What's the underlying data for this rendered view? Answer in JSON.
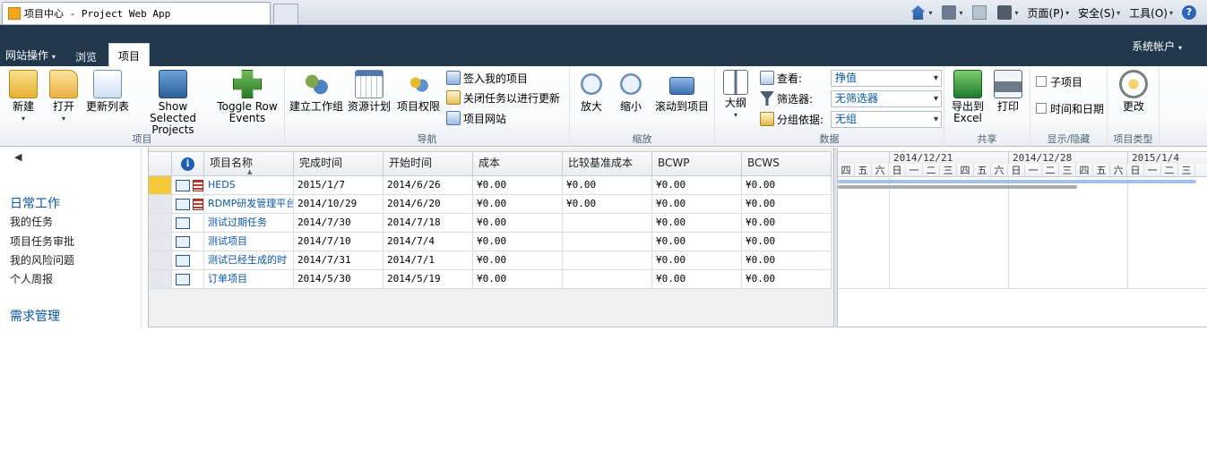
{
  "browser": {
    "tab_title": "项目中心 - Project Web App",
    "commands": [
      {
        "label": "",
        "icon": "home-icon"
      },
      {
        "label": "",
        "icon": "rss-icon"
      },
      {
        "label": "",
        "icon": "mail-icon"
      },
      {
        "label": "",
        "icon": "print-icon"
      },
      {
        "label": "页面(P)",
        "icon": ""
      },
      {
        "label": "安全(S)",
        "icon": ""
      },
      {
        "label": "工具(O)",
        "icon": ""
      },
      {
        "label": "",
        "icon": "help-icon"
      }
    ]
  },
  "header": {
    "site_actions": "网站操作",
    "tab_browse": "浏览",
    "tab_project": "项目",
    "account": "系统帐户"
  },
  "ribbon": {
    "group_project": {
      "label": "项目",
      "new": "新建",
      "open": "打开",
      "refresh_list": "更新列表",
      "show_selected_1": "Show Selected",
      "show_selected_2": "Projects",
      "toggle_row_1": "Toggle Row",
      "toggle_row_2": "Events"
    },
    "group_navigate": {
      "label": "导航",
      "build_team": "建立工作组",
      "resource_plan": "资源计划",
      "project_permissions": "项目权限",
      "check_in": "签入我的项目",
      "close_tasks": "关闭任务以进行更新",
      "project_site": "项目网站"
    },
    "group_zoom": {
      "label": "缩放",
      "zoom_in": "放大",
      "zoom_out": "缩小",
      "scroll_to_project": "滚动到项目"
    },
    "group_data": {
      "label": "数据",
      "outline": "大纲",
      "view_label": "查看:",
      "view_value": "挣值",
      "filter_label": "筛选器:",
      "filter_value": "无筛选器",
      "group_by_label": "分组依据:",
      "group_by_value": "无组"
    },
    "group_share": {
      "label": "共享",
      "export_1": "导出到",
      "export_2": "Excel",
      "print": "打印"
    },
    "group_showhide": {
      "label": "显示/隐藏",
      "subprojects": "子项目",
      "time_and_date": "时间和日期"
    },
    "group_projecttype": {
      "label": "项目类型",
      "change": "更改"
    }
  },
  "leftnav": {
    "back_icon": "◀",
    "heading1": "日常工作",
    "items": [
      "我的任务",
      "项目任务审批",
      "我的风险问题",
      "个人周报"
    ],
    "heading2": "需求管理"
  },
  "grid": {
    "columns": [
      "项目名称",
      "完成时间",
      "开始时间",
      "成本",
      "比较基准成本",
      "BCWP",
      "BCWS"
    ],
    "rows": [
      {
        "name": "HEDS",
        "finish": "2015/1/7",
        "start": "2014/6/26",
        "cost": "¥0.00",
        "baseline": "¥0.00",
        "bcwp": "¥0.00",
        "bcws": "¥0.00",
        "icons": 2,
        "selected": true
      },
      {
        "name": "RDMP研发管理平台",
        "finish": "2014/10/29",
        "start": "2014/6/20",
        "cost": "¥0.00",
        "baseline": "¥0.00",
        "bcwp": "¥0.00",
        "bcws": "¥0.00",
        "icons": 2,
        "selected": false
      },
      {
        "name": "测试过期任务",
        "finish": "2014/7/30",
        "start": "2014/7/18",
        "cost": "¥0.00",
        "baseline": "",
        "bcwp": "¥0.00",
        "bcws": "¥0.00",
        "icons": 1,
        "selected": false
      },
      {
        "name": "测试项目",
        "finish": "2014/7/10",
        "start": "2014/7/4",
        "cost": "¥0.00",
        "baseline": "",
        "bcwp": "¥0.00",
        "bcws": "¥0.00",
        "icons": 1,
        "selected": false
      },
      {
        "name": "测试已经生成的时",
        "finish": "2014/7/31",
        "start": "2014/7/1",
        "cost": "¥0.00",
        "baseline": "",
        "bcwp": "¥0.00",
        "bcws": "¥0.00",
        "icons": 1,
        "selected": false
      },
      {
        "name": "订单项目",
        "finish": "2014/5/30",
        "start": "2014/5/19",
        "cost": "¥0.00",
        "baseline": "",
        "bcwp": "¥0.00",
        "bcws": "¥0.00",
        "icons": 1,
        "selected": false
      }
    ]
  },
  "gantt": {
    "weeks": [
      "2014/12/21",
      "2014/12/28",
      "2015/1/4"
    ],
    "days": [
      "四",
      "五",
      "六",
      "日",
      "一",
      "二",
      "三",
      "四",
      "五",
      "六",
      "日",
      "一",
      "二",
      "三",
      "四",
      "五",
      "六",
      "日",
      "一",
      "二",
      "三"
    ],
    "bar_colors": [
      "#9fc3ea",
      "#a9acaf"
    ]
  }
}
